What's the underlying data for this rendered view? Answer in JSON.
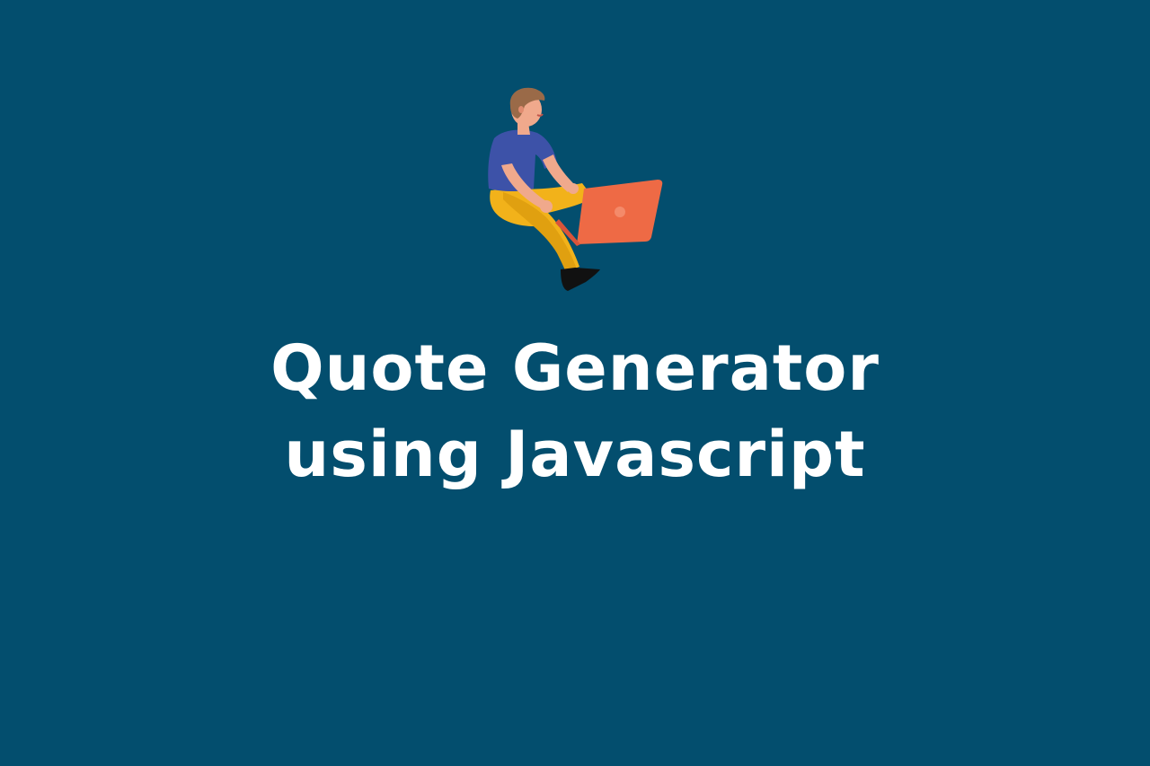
{
  "page": {
    "background_color": "#034e6e",
    "text_color": "#ffffff"
  },
  "illustration": {
    "icon": "person-with-laptop-icon",
    "colors": {
      "shirt": "#3d52a8",
      "pants": "#f2b21a",
      "laptop": "#ee6a45",
      "skin": "#f0a98c",
      "hair": "#9a6a48",
      "shoe": "#111111"
    }
  },
  "title": {
    "line1": "Quote Generator",
    "line2": "using Javascript"
  }
}
